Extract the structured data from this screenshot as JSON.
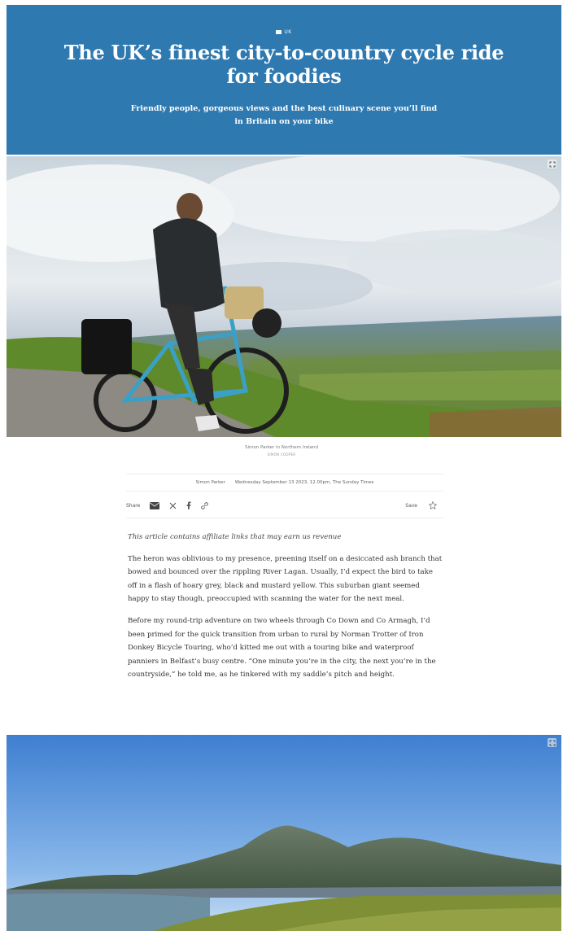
{
  "hero": {
    "tag": "UK",
    "title": "The UK’s finest city-to-country cycle ride for foodies",
    "subtitle": "Friendly people, gorgeous views and the best culinary scene you’ll find in Britain on your bike",
    "background": "#2e79b0"
  },
  "photo1": {
    "alt": "Simon Parker in Northern Ireland",
    "caption": "Simon Parker in Northern Ireland",
    "credit": "SIMON COOPER"
  },
  "byline": {
    "author": "Simon Parker",
    "date": "Wednesday September 13 2023, 12.00pm, The Sunday Times"
  },
  "share": {
    "label": "Share",
    "icons": [
      "email-icon",
      "x-icon",
      "facebook-icon",
      "link-icon"
    ],
    "save_label": "Save",
    "save_icon": "star-icon"
  },
  "article": {
    "affiliate": "This article contains affiliate links that may earn us revenue",
    "paragraphs": [
      "The heron was oblivious to my presence, preening itself on a desiccated ash branch that bowed and bounced over the rippling River Lagan. Usually, I’d expect the bird to take off in a flash of hoary grey, black and mustard yellow. This suburban giant seemed happy to stay though, preoccupied with scanning the water for the next meal.",
      "Before my round-trip adventure on two wheels through Co Down and Co Armagh, I’d been primed for the quick transition from urban to rural by Norman Trotter of Iron Donkey Bicycle Touring, who’d kitted me out with a touring bike and waterproof panniers in Belfast’s busy centre. “One minute you’re in the city, the next you’re in the countryside,” he told me, as he tinkered with my saddle’s pitch and height."
    ]
  }
}
